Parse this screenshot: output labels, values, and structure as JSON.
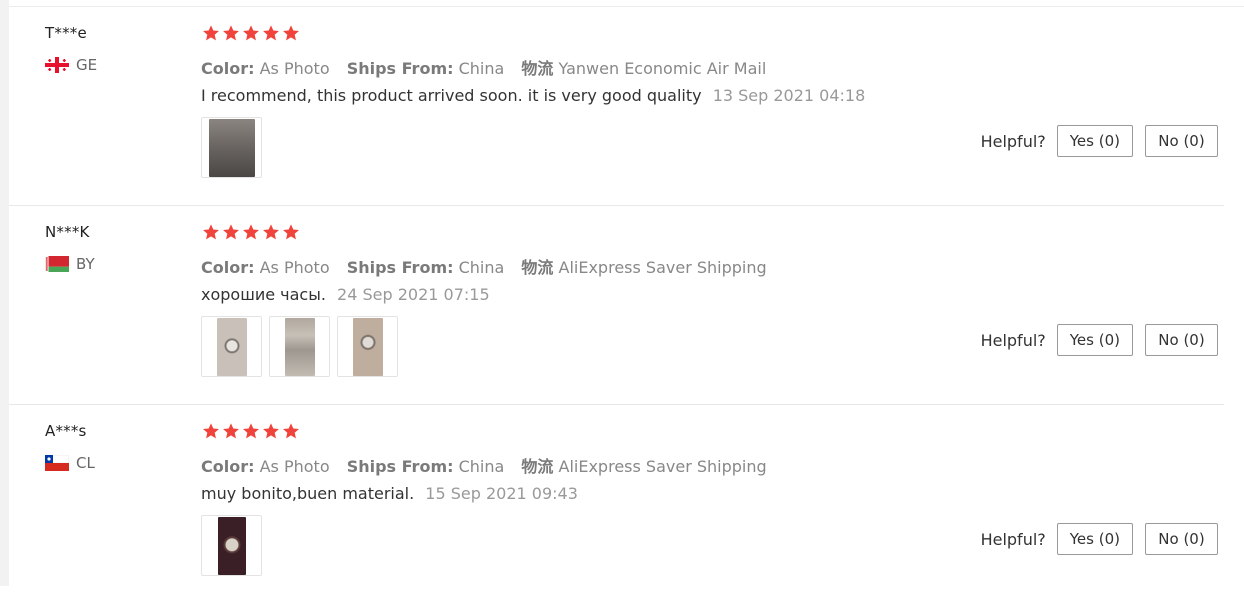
{
  "meta_labels": {
    "color": "Color:",
    "ships_from": "Ships From:",
    "logistics": "物流"
  },
  "helpful": {
    "label": "Helpful?",
    "yes": "Yes (0)",
    "no": "No (0)"
  },
  "colors": {
    "star": "#f0433c",
    "border": "#e8e8e8"
  },
  "reviews": [
    {
      "user": "T***e",
      "country": "GE",
      "flag_icon": "georgia-flag-icon",
      "rating": 5,
      "color": "As Photo",
      "ships_from": "China",
      "shipping": "Yanwen Economic Air Mail",
      "comment": "I recommend, this product arrived soon. it is very good quality",
      "time": "13 Sep 2021 04:18",
      "photos": [
        "photo-1"
      ]
    },
    {
      "user": "N***K",
      "country": "BY",
      "flag_icon": "belarus-flag-icon",
      "rating": 5,
      "color": "As Photo",
      "ships_from": "China",
      "shipping": "AliExpress Saver Shipping",
      "comment": "хорошие часы.",
      "time": "24 Sep 2021 07:15",
      "photos": [
        "photo-1",
        "photo-2",
        "photo-3"
      ]
    },
    {
      "user": "A***s",
      "country": "CL",
      "flag_icon": "chile-flag-icon",
      "rating": 5,
      "color": "As Photo",
      "ships_from": "China",
      "shipping": "AliExpress Saver Shipping",
      "comment": "muy bonito,buen material.",
      "time": "15 Sep 2021 09:43",
      "photos": [
        "photo-1"
      ]
    }
  ]
}
